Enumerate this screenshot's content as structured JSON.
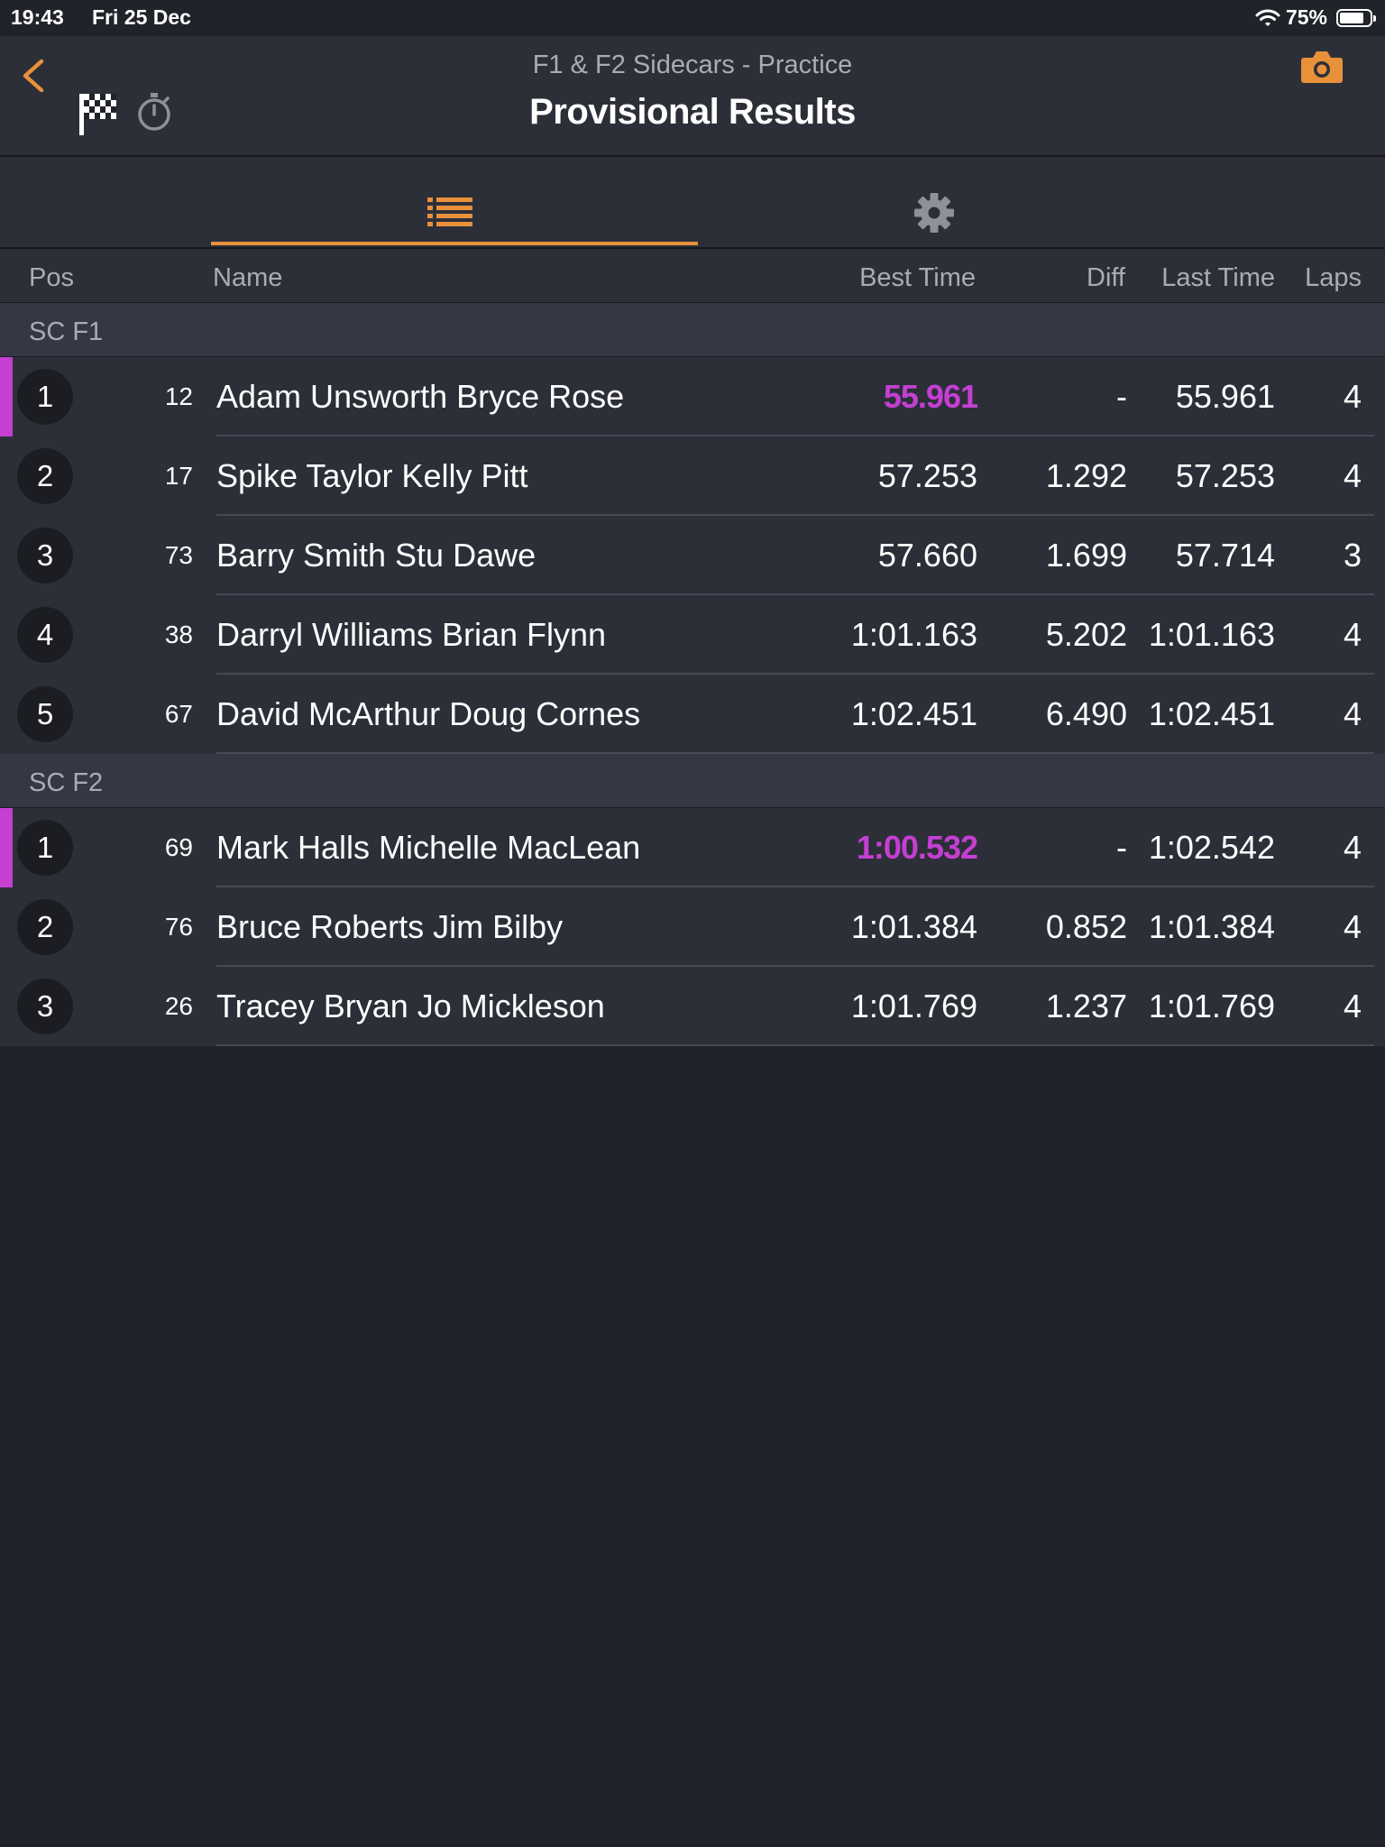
{
  "status_bar": {
    "time": "19:43",
    "date": "Fri 25 Dec",
    "battery": "75%"
  },
  "nav": {
    "subtitle": "F1 & F2 Sidecars - Practice",
    "title": "Provisional Results",
    "accent_color": "#e8913a"
  },
  "tabs": [
    {
      "icon": "list-icon",
      "active": true
    },
    {
      "icon": "gear-icon",
      "active": false
    }
  ],
  "columns": {
    "pos": "Pos",
    "name": "Name",
    "best_time": "Best Time",
    "diff": "Diff",
    "last_time": "Last Time",
    "laps": "Laps"
  },
  "highlight_color": "#c53fd3",
  "sections": [
    {
      "title": "SC F1",
      "rows": [
        {
          "pos": "1",
          "num": "12",
          "name": "Adam Unsworth Bryce Rose",
          "best": "55.961",
          "diff": "-",
          "last": "55.961",
          "laps": "4",
          "fastest": true
        },
        {
          "pos": "2",
          "num": "17",
          "name": "Spike Taylor Kelly Pitt",
          "best": "57.253",
          "diff": "1.292",
          "last": "57.253",
          "laps": "4",
          "fastest": false
        },
        {
          "pos": "3",
          "num": "73",
          "name": "Barry Smith Stu Dawe",
          "best": "57.660",
          "diff": "1.699",
          "last": "57.714",
          "laps": "3",
          "fastest": false
        },
        {
          "pos": "4",
          "num": "38",
          "name": "Darryl Williams Brian Flynn",
          "best": "1:01.163",
          "diff": "5.202",
          "last": "1:01.163",
          "laps": "4",
          "fastest": false
        },
        {
          "pos": "5",
          "num": "67",
          "name": "David McArthur Doug Cornes",
          "best": "1:02.451",
          "diff": "6.490",
          "last": "1:02.451",
          "laps": "4",
          "fastest": false
        }
      ]
    },
    {
      "title": "SC F2",
      "rows": [
        {
          "pos": "1",
          "num": "69",
          "name": "Mark Halls Michelle MacLean",
          "best": "1:00.532",
          "diff": "-",
          "last": "1:02.542",
          "laps": "4",
          "fastest": true
        },
        {
          "pos": "2",
          "num": "76",
          "name": "Bruce Roberts Jim Bilby",
          "best": "1:01.384",
          "diff": "0.852",
          "last": "1:01.384",
          "laps": "4",
          "fastest": false
        },
        {
          "pos": "3",
          "num": "26",
          "name": "Tracey Bryan Jo Mickleson",
          "best": "1:01.769",
          "diff": "1.237",
          "last": "1:01.769",
          "laps": "4",
          "fastest": false
        }
      ]
    }
  ]
}
